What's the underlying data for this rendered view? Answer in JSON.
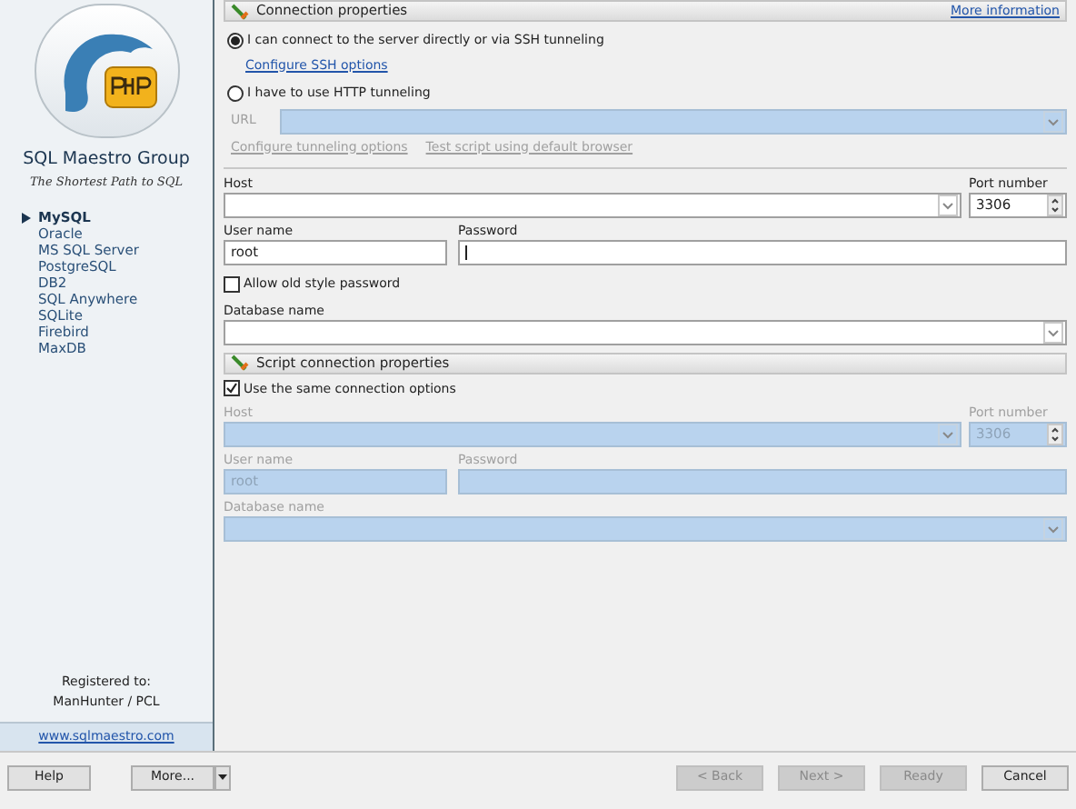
{
  "sidebar": {
    "company": "SQL Maestro Group",
    "tagline": "The Shortest Path to SQL",
    "databases": [
      {
        "label": "MySQL",
        "selected": true
      },
      {
        "label": "Oracle",
        "selected": false
      },
      {
        "label": "MS SQL Server",
        "selected": false
      },
      {
        "label": "PostgreSQL",
        "selected": false
      },
      {
        "label": "DB2",
        "selected": false
      },
      {
        "label": "SQL Anywhere",
        "selected": false
      },
      {
        "label": "SQLite",
        "selected": false
      },
      {
        "label": "Firebird",
        "selected": false
      },
      {
        "label": "MaxDB",
        "selected": false
      }
    ],
    "registered_label": "Registered to:",
    "registered_to": "ManHunter / PCL",
    "website": "www.sqlmaestro.com"
  },
  "connection": {
    "title": "Connection properties",
    "more_info": "More information",
    "modes": [
      {
        "label": "I can connect to the server directly or via SSH tunneling",
        "selected": true,
        "links": [
          "Configure SSH options"
        ]
      },
      {
        "label": "I have to use HTTP tunneling",
        "selected": false
      }
    ],
    "url": {
      "label": "URL",
      "disabled": true,
      "links": [
        "Configure tunneling options",
        "Test script using default browser"
      ]
    },
    "host": {
      "label": "Host",
      "disabled": false
    },
    "port": {
      "label": "Port number",
      "value": "3306",
      "disabled": false
    },
    "user": {
      "label": "User name",
      "value": "root",
      "disabled": false
    },
    "password": {
      "label": "Password",
      "disabled": false
    },
    "old_password": {
      "label": "Allow old style password",
      "checked": false
    },
    "database": {
      "label": "Database name",
      "disabled": false
    }
  },
  "script": {
    "title": "Script connection properties",
    "same_options": {
      "label": "Use the same connection options",
      "checked": true
    },
    "host": {
      "label": "Host",
      "disabled": true
    },
    "port": {
      "label": "Port number",
      "value": "3306",
      "disabled": true
    },
    "user": {
      "label": "User name",
      "value": "root",
      "disabled": true
    },
    "password": {
      "label": "Password",
      "disabled": true
    },
    "database": {
      "label": "Database name",
      "disabled": true
    }
  },
  "buttons": {
    "left": [
      {
        "label": "Help",
        "kind": "plain",
        "disabled": false
      },
      {
        "label": "More...",
        "kind": "split",
        "disabled": false
      }
    ],
    "right": [
      {
        "label": "< Back",
        "disabled": true
      },
      {
        "label": "Next >",
        "disabled": true
      },
      {
        "label": "Ready",
        "disabled": true
      },
      {
        "label": "Cancel",
        "disabled": false
      }
    ]
  }
}
